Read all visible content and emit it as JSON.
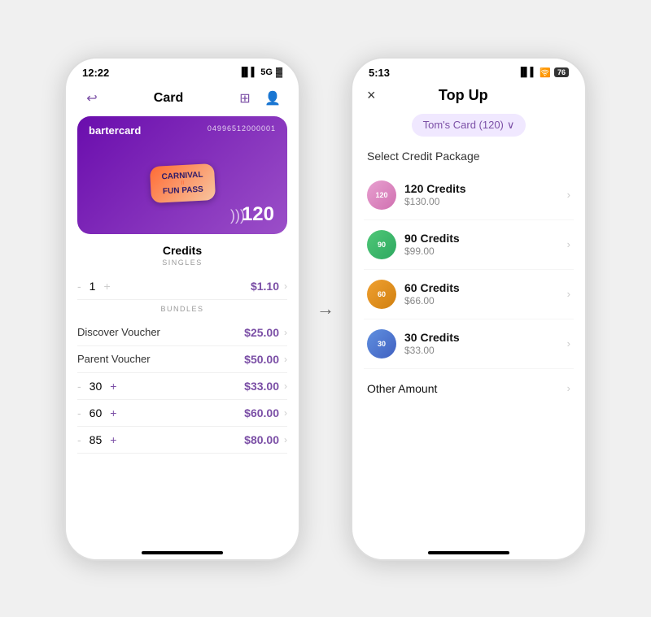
{
  "phone1": {
    "status": {
      "time": "12:22",
      "signal": "5G",
      "battery": "🔋"
    },
    "header": {
      "title": "Card",
      "back_icon": "↩",
      "scan_icon": "⊞",
      "profile_icon": "👤"
    },
    "card": {
      "brand": "bartercard",
      "number": "04996512000001",
      "carnival_line1": "CARNIVAL",
      "carnival_line2": "FUN PASS",
      "credits": "120"
    },
    "credits_section": {
      "title": "Credits",
      "singles_label": "SINGLES",
      "bundles_label": "BUNDLES",
      "singles_qty": "1",
      "singles_price": "$1.10",
      "bundles": [
        {
          "label": "Discover Voucher",
          "price": "$25.00"
        },
        {
          "label": "Parent Voucher",
          "price": "$50.00"
        }
      ],
      "quantities": [
        {
          "qty": "30",
          "price": "$33.00"
        },
        {
          "qty": "60",
          "price": "$60.00"
        },
        {
          "qty": "85",
          "price": "$80.00"
        }
      ]
    }
  },
  "phone2": {
    "status": {
      "time": "5:13",
      "signal": "WiFi"
    },
    "header": {
      "close_label": "×",
      "title": "Top Up"
    },
    "card_selector": {
      "label": "Tom's Card (120)",
      "chevron": "∨"
    },
    "select_label": "Select Credit Package",
    "packages": [
      {
        "id": "120",
        "credits": "120 Credits",
        "price": "$130.00",
        "icon_label": "120",
        "icon_class": "pkg-icon-120"
      },
      {
        "id": "90",
        "credits": "90 Credits",
        "price": "$99.00",
        "icon_label": "90",
        "icon_class": "pkg-icon-90"
      },
      {
        "id": "60",
        "credits": "60 Credits",
        "price": "$66.00",
        "icon_label": "60",
        "icon_class": "pkg-icon-60"
      },
      {
        "id": "30",
        "credits": "30 Credits",
        "price": "$33.00",
        "icon_label": "30",
        "icon_class": "pkg-icon-30"
      }
    ],
    "other_amount_label": "Other Amount"
  },
  "arrow": "→"
}
